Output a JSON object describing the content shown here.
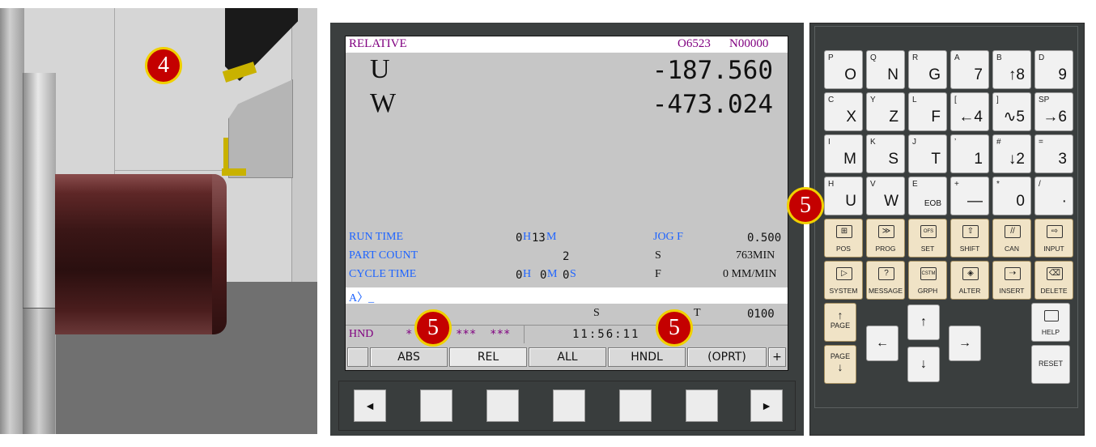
{
  "markers": {
    "m4": "4",
    "m5a": "5",
    "m5b": "5",
    "m5c": "5"
  },
  "screen": {
    "mode": "RELATIVE",
    "program": "O6523",
    "sequence": "N00000",
    "axes": [
      {
        "name": "U",
        "value": "-187.560"
      },
      {
        "name": "W",
        "value": "-473.024"
      }
    ],
    "run_time": {
      "label": "RUN TIME",
      "h": "0",
      "h_unit": "H",
      "m": "13",
      "m_unit": "M"
    },
    "part_count": {
      "label": "PART COUNT",
      "value": "2"
    },
    "cycle_time": {
      "label": "CYCLE TIME",
      "h": "0",
      "h_unit": "H",
      "m": "0",
      "m_unit": "M",
      "s": "0",
      "s_unit": "S"
    },
    "jog_f": {
      "label": "JOG F",
      "value": "0.500"
    },
    "spindle": {
      "label": "S",
      "value": "763MIN"
    },
    "feed": {
      "label": "F",
      "value": "0 MM/MIN"
    },
    "input_prompt": "A〉_",
    "status_s_label": "S",
    "status_t_label": "T",
    "status_t_value": "0100",
    "mode_hnd": "HND",
    "stars_left": "*",
    "stars_right": "***  ***",
    "clock": "11:56:11",
    "softkeys": [
      "ABS",
      "REL",
      "ALL",
      "HNDL",
      "(OPRT)"
    ],
    "softkey_more": "+"
  },
  "hw_keys": {
    "left": "◄",
    "right": "►"
  },
  "keypad": {
    "row1": [
      {
        "sub": "P",
        "main": "O"
      },
      {
        "sub": "Q",
        "main": "N"
      },
      {
        "sub": "R",
        "main": "G"
      },
      {
        "sub": "A",
        "main": "7"
      },
      {
        "sub": "B",
        "main": "↑8"
      },
      {
        "sub": "D",
        "main": "9"
      }
    ],
    "row2": [
      {
        "sub": "C",
        "main": "X"
      },
      {
        "sub": "Y",
        "main": "Z"
      },
      {
        "sub": "L",
        "main": "F"
      },
      {
        "sub": "[",
        "main": "←4"
      },
      {
        "sub": "]",
        "main": "∿5"
      },
      {
        "sub": "SP",
        "main": "→6"
      }
    ],
    "row3": [
      {
        "sub": "I",
        "main": "M"
      },
      {
        "sub": "K",
        "main": "S"
      },
      {
        "sub": "J",
        "main": "T"
      },
      {
        "sub": "’",
        "main": "1"
      },
      {
        "sub": "#",
        "main": "↓2"
      },
      {
        "sub": "=",
        "main": "3"
      }
    ],
    "row4": [
      {
        "sub": "H",
        "main": "U"
      },
      {
        "sub": "V",
        "main": "W"
      },
      {
        "sub": "E",
        "main": "EOB"
      },
      {
        "sub": "+",
        "main": "—"
      },
      {
        "sub": "*",
        "main": "0"
      },
      {
        "sub": "/",
        "main": "·"
      }
    ],
    "func1": [
      {
        "icon": "⊞",
        "label": "POS"
      },
      {
        "icon": "≫",
        "label": "PROG"
      },
      {
        "icon": "OFS",
        "label": "SET"
      },
      {
        "icon": "⇧",
        "label": "SHIFT"
      },
      {
        "icon": "//",
        "label": "CAN"
      },
      {
        "icon": "⇨",
        "label": "INPUT"
      }
    ],
    "func2": [
      {
        "icon": "▷",
        "label": "SYSTEM"
      },
      {
        "icon": "?",
        "label": "MESSAGE"
      },
      {
        "icon": "CSTM",
        "label": "GRPH"
      },
      {
        "icon": "◈",
        "label": "ALTER"
      },
      {
        "icon": "⇢",
        "label": "INSERT"
      },
      {
        "icon": "⌫",
        "label": "DELETE"
      }
    ],
    "page_up": "PAGE",
    "page_down": "PAGE",
    "help": "HELP",
    "reset": "RESET",
    "arrows": {
      "up": "↑",
      "down": "↓",
      "left": "←",
      "right": "→"
    },
    "page_up_arrow": "↑",
    "page_down_arrow": "↓"
  }
}
